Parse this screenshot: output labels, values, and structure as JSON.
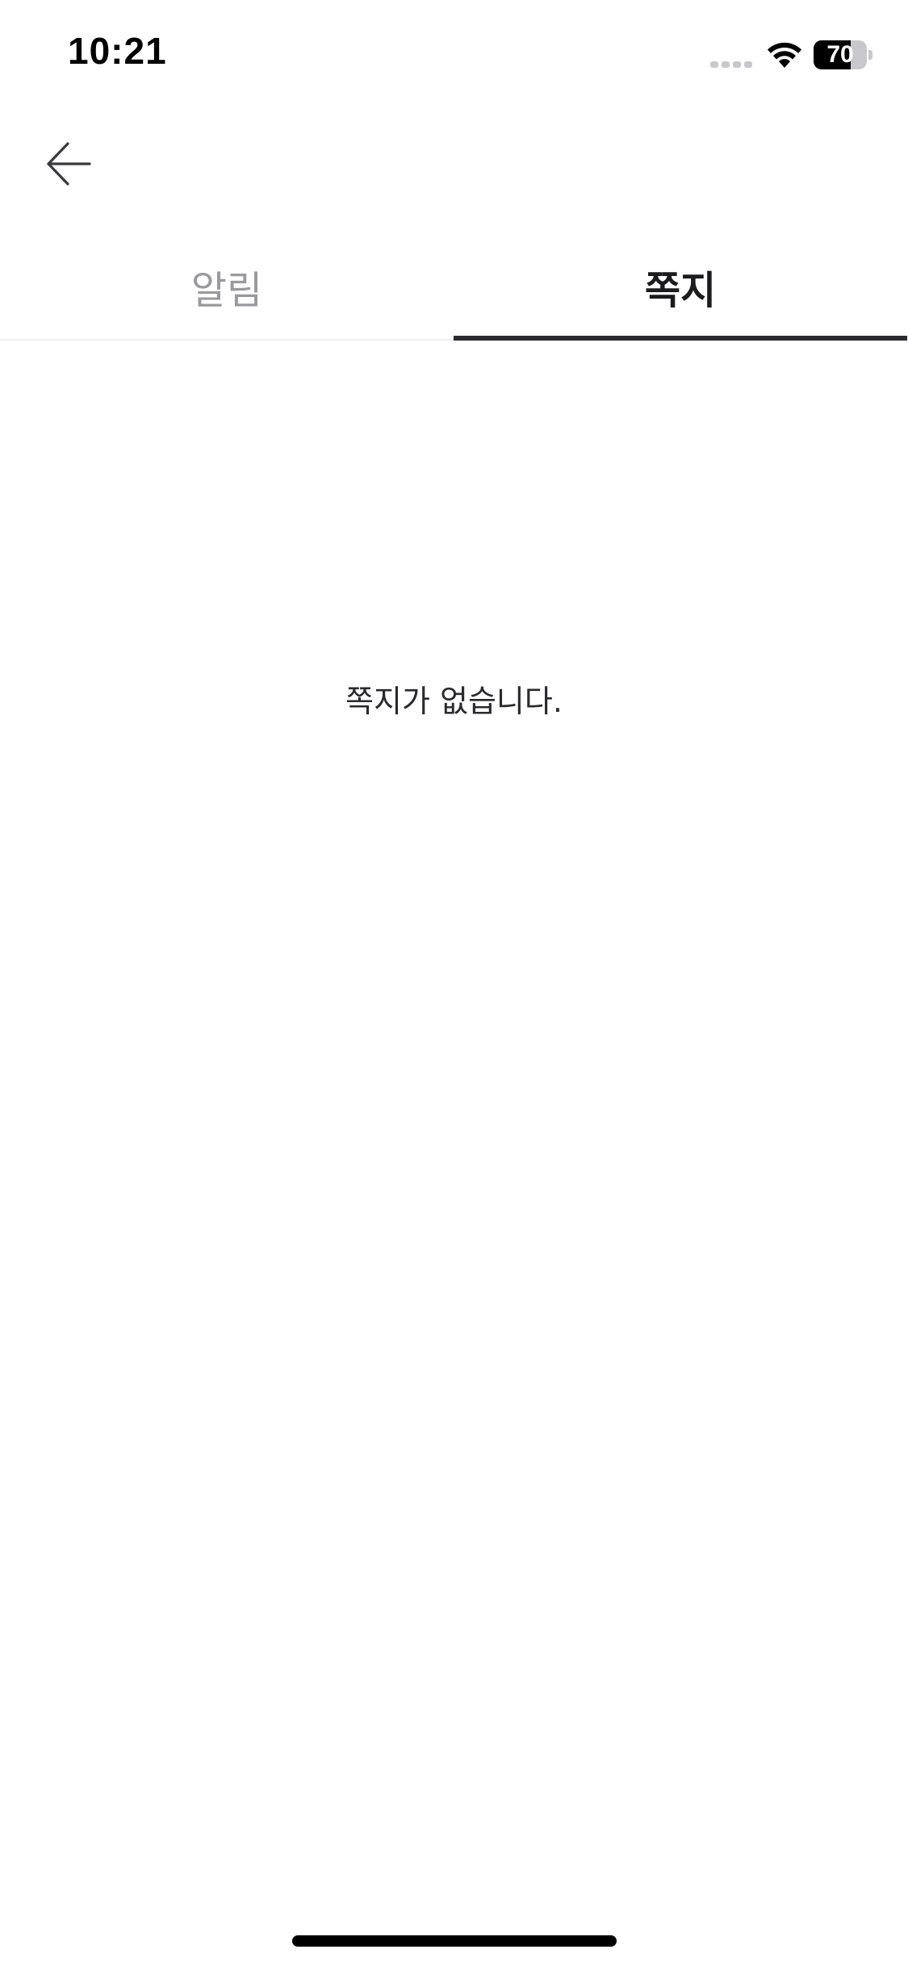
{
  "status_bar": {
    "time": "10:21",
    "battery_level": "70",
    "battery_fraction": 0.7,
    "cell_signal_icon": "cell-signal-icon",
    "wifi_icon": "wifi-icon"
  },
  "nav": {
    "back_icon": "arrow-left-icon"
  },
  "tabs": [
    {
      "label": "알림",
      "active": false
    },
    {
      "label": "쪽지",
      "active": true
    }
  ],
  "empty_state": {
    "message": "쪽지가 없습니다."
  },
  "colors": {
    "background": "#ffffff",
    "active_tab_text": "#1c1c1e",
    "inactive_tab_text": "#9a9a9e",
    "tab_indicator": "#2c2c30"
  }
}
